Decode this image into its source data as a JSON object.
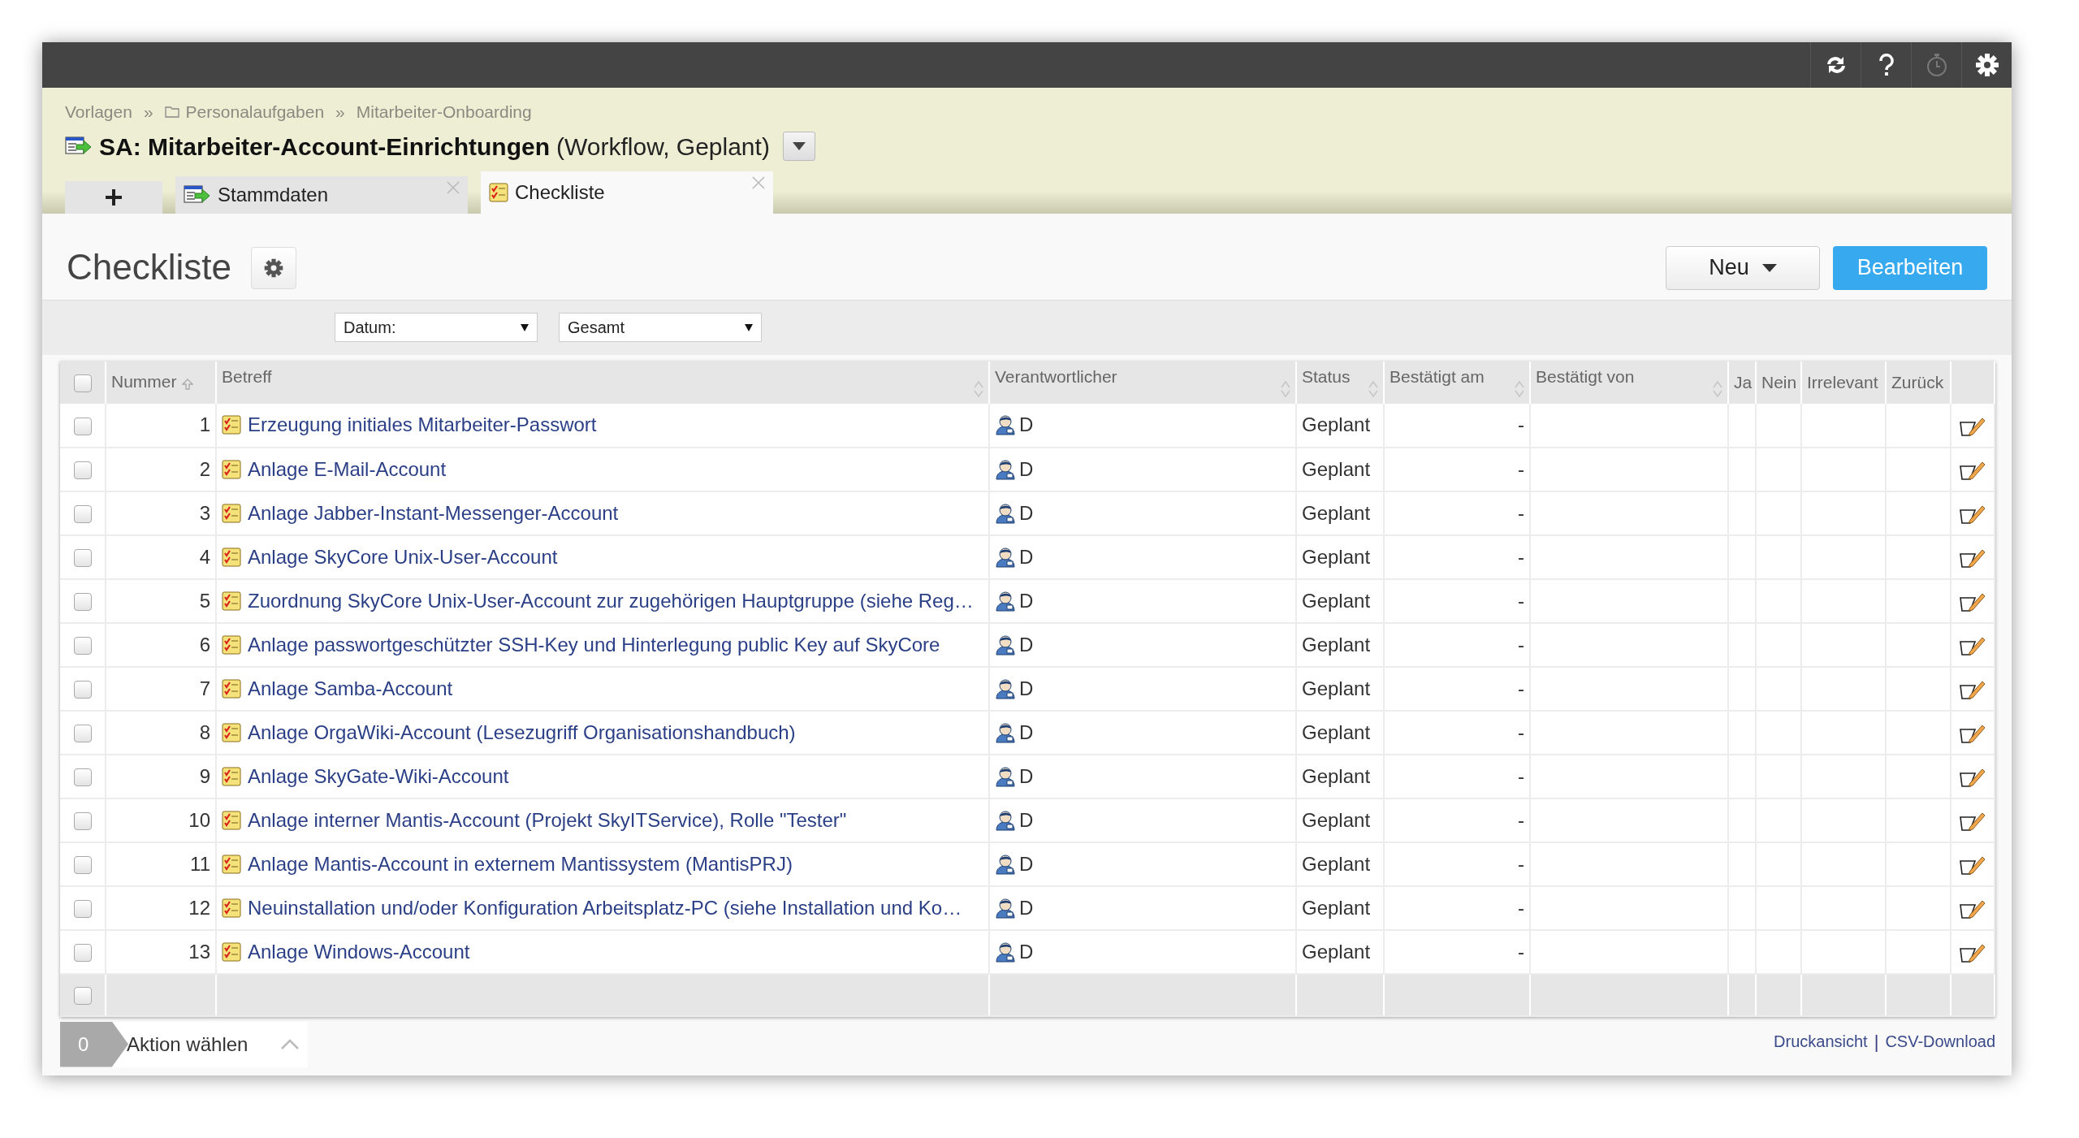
{
  "toolbar": [
    {
      "kind": "sync",
      "disabled": false
    },
    {
      "kind": "help",
      "disabled": false
    },
    {
      "kind": "timer",
      "disabled": true
    },
    {
      "kind": "settings",
      "disabled": false
    }
  ],
  "breadcrumbs": [
    {
      "label": "Vorlagen",
      "folder": false
    },
    {
      "separator_before": "»",
      "label": "Personalaufgaben",
      "folder": true
    },
    {
      "separator_before": "»",
      "label": "Mitarbeiter-Onboarding",
      "folder": false
    }
  ],
  "title": {
    "name": "SA: Mitarbeiter-Account-Einrichtungen",
    "meta": "(Workflow, Geplant)"
  },
  "tabs": [
    {
      "label": "Stammdaten",
      "kind": "workflow",
      "selected": false
    },
    {
      "label": "Checkliste",
      "kind": "checklist",
      "selected": true
    }
  ],
  "page_title": "Checkliste",
  "buttons": {
    "new": "Neu",
    "edit": "Bearbeiten"
  },
  "filters": [
    {
      "value": "Datum:"
    },
    {
      "value": "Gesamt"
    }
  ],
  "table": {
    "all_checked": false,
    "footer_checked": false,
    "columns": [
      {
        "label": "Nummer",
        "sortable": true,
        "sorted_ascending": true
      },
      {
        "label": "Betreff",
        "sortable": true,
        "sorted_ascending": false
      },
      {
        "label": "Verantwortlicher",
        "sortable": true,
        "sorted_ascending": false
      },
      {
        "label": "Status",
        "sortable": true,
        "sorted_ascending": false
      },
      {
        "label": "Bestätigt am",
        "sortable": true,
        "sorted_ascending": false
      },
      {
        "label": "Bestätigt von",
        "sortable": true,
        "sorted_ascending": false
      },
      {
        "label": "Ja",
        "sortable": false
      },
      {
        "label": "Nein",
        "sortable": false
      },
      {
        "label": "Irrelevant",
        "sortable": false
      },
      {
        "label": "Zurück",
        "sortable": false
      }
    ],
    "rows": [
      {
        "checked": false,
        "number": "1",
        "subject": "Erzeugung initiales Mitarbeiter-Passwort",
        "responsible": "D",
        "status": "Geplant",
        "confirmed_at": "-"
      },
      {
        "checked": false,
        "number": "2",
        "subject": "Anlage E-Mail-Account",
        "responsible": "D",
        "status": "Geplant",
        "confirmed_at": "-"
      },
      {
        "checked": false,
        "number": "3",
        "subject": "Anlage Jabber-Instant-Messenger-Account",
        "responsible": "D",
        "status": "Geplant",
        "confirmed_at": "-"
      },
      {
        "checked": false,
        "number": "4",
        "subject": "Anlage SkyCore Unix-User-Account",
        "responsible": "D",
        "status": "Geplant",
        "confirmed_at": "-"
      },
      {
        "checked": false,
        "number": "5",
        "subject": "Zuordnung SkyCore Unix-User-Account zur zugehörigen Hauptgruppe (siehe Reg…",
        "responsible": "D",
        "status": "Geplant",
        "confirmed_at": "-"
      },
      {
        "checked": false,
        "number": "6",
        "subject": "Anlage passwortgeschützter SSH-Key und Hinterlegung public Key auf SkyCore",
        "responsible": "D",
        "status": "Geplant",
        "confirmed_at": "-"
      },
      {
        "checked": false,
        "number": "7",
        "subject": "Anlage Samba-Account",
        "responsible": "D",
        "status": "Geplant",
        "confirmed_at": "-"
      },
      {
        "checked": false,
        "number": "8",
        "subject": "Anlage OrgaWiki-Account (Lesezugriff Organisationshandbuch)",
        "responsible": "D",
        "status": "Geplant",
        "confirmed_at": "-"
      },
      {
        "checked": false,
        "number": "9",
        "subject": "Anlage SkyGate-Wiki-Account",
        "responsible": "D",
        "status": "Geplant",
        "confirmed_at": "-"
      },
      {
        "checked": false,
        "number": "10",
        "subject": "Anlage interner Mantis-Account (Projekt SkyITService), Rolle \"Tester\"",
        "responsible": "D",
        "status": "Geplant",
        "confirmed_at": "-"
      },
      {
        "checked": false,
        "number": "11",
        "subject": "Anlage Mantis-Account in externem Mantissystem (MantisPRJ)",
        "responsible": "D",
        "status": "Geplant",
        "confirmed_at": "-"
      },
      {
        "checked": false,
        "number": "12",
        "subject": "Neuinstallation und/oder Konfiguration Arbeitsplatz-PC (siehe Installation und Ko…",
        "responsible": "D",
        "status": "Geplant",
        "confirmed_at": "-"
      },
      {
        "checked": false,
        "number": "13",
        "subject": "Anlage Windows-Account",
        "responsible": "D",
        "status": "Geplant",
        "confirmed_at": "-"
      }
    ]
  },
  "bulk": {
    "count": "0",
    "label": "Aktion wählen"
  },
  "footer_links": [
    {
      "label": "Druckansicht"
    },
    {
      "separator_before": "|",
      "label": "CSV-Download"
    }
  ]
}
